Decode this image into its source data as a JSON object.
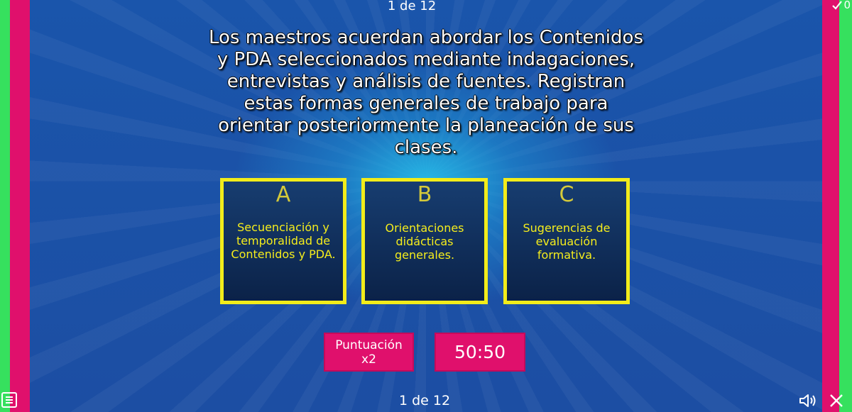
{
  "header": {
    "counter": "1 de 12",
    "score_icon": "check-icon",
    "score_value": "0"
  },
  "question": {
    "text": "Los maestros acuerdan abordar los Contenidos y PDA seleccionados mediante indagaciones, entrevistas y análisis de fuentes. Registran estas formas generales de trabajo para orientar posteriormente la planeación de sus clases."
  },
  "answers": [
    {
      "letter": "A",
      "text": "Secuenciación y temporalidad de Contenidos y PDA."
    },
    {
      "letter": "B",
      "text": "Orientaciones didácticas generales."
    },
    {
      "letter": "C",
      "text": "Sugerencias de evaluación formativa."
    }
  ],
  "score_box": {
    "label": "Puntuación",
    "multiplier": "x2"
  },
  "timer": {
    "value": "50:50"
  },
  "footer": {
    "counter": "1 de 12",
    "menu_icon": "menu-icon",
    "sound_icon": "speaker-icon",
    "close_icon": "close-icon"
  },
  "colors": {
    "background": "#1d4fa5",
    "accent_pink": "#e0106c",
    "accent_green": "#36e05e",
    "answer_border": "#f2ec1a",
    "answer_text": "#f5ed1c"
  }
}
